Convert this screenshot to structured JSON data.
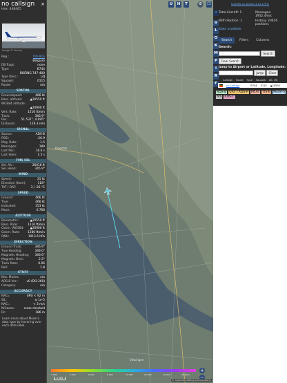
{
  "left_panel": {
    "callsign": "no callsign",
    "hex": "Hex: 448465",
    "close_glyph": "×",
    "photo_credit": "Image © Sxuuzy",
    "basic": [
      {
        "k": "Reg.:",
        "v": "OO-ACE",
        "link": true
      },
      {
        "k": "",
        "v": "Belgium",
        "link": false
      },
      {
        "k": "DB flags:",
        "v": "none",
        "link": false
      },
      {
        "k": "Type:",
        "v": "B744",
        "link": false
      },
      {
        "k": "",
        "v": "BOEING 747-400",
        "link": false
      },
      {
        "k": "Type Desc.:",
        "v": "L4J",
        "link": false
      },
      {
        "k": "Squawk:",
        "v": "0115",
        "link": false
      },
      {
        "k": "Route:",
        "v": "n/a",
        "link": false
      }
    ],
    "sections": [
      {
        "title": "SPATIAL",
        "rows": [
          {
            "k": "Groundspeed:",
            "v": "466 kt"
          },
          {
            "k": "Baro. altitude:",
            "v": "▲20550 ft"
          },
          {
            "k": "WGS84 altitude:",
            "v": ""
          },
          {
            "k": "",
            "v": "▲20900 ft"
          },
          {
            "k": "Vert. Rate:",
            "v": "1216 ft/min"
          },
          {
            "k": "Track:",
            "v": "346.9°"
          },
          {
            "k": "Pos.:",
            "v": "51.537°, 4.095°"
          },
          {
            "k": "Distance:",
            "v": "119.3 nmi"
          }
        ]
      },
      {
        "title": "SIGNAL",
        "rows": [
          {
            "k": "Source:",
            "v": "ADS-B"
          },
          {
            "k": "RSSI:",
            "v": "-26.9"
          },
          {
            "k": "Msg. Rate:",
            "v": "1.5"
          },
          {
            "k": "Messages:",
            "v": "189"
          },
          {
            "k": "Last Pos.:",
            "v": "16.6 s"
          },
          {
            "k": "Last Seen:",
            "v": "1.5 s"
          }
        ]
      },
      {
        "title": "FMS SEL",
        "rows": [
          {
            "k": "Sel. Alt.:",
            "v": "26016 ft"
          },
          {
            "k": "Sel. Head.:",
            "v": "345.9°"
          }
        ]
      },
      {
        "title": "WIND",
        "rows": [
          {
            "k": "Speed:",
            "v": "25 kt"
          },
          {
            "k": "Direction (from):",
            "v": "118°"
          },
          {
            "k": "TAT / OAT:",
            "v": "3 / -26 °C"
          }
        ]
      },
      {
        "title": "SPEED",
        "rows": [
          {
            "k": "Ground:",
            "v": "466 kt"
          },
          {
            "k": "True:",
            "v": "466 kt"
          },
          {
            "k": "Indicated:",
            "v": "353 kt"
          },
          {
            "k": "Mach:",
            "v": "0.768"
          }
        ]
      },
      {
        "title": "ALTITUDE",
        "rows": [
          {
            "k": "Barometric:",
            "v": "▲20550 ft"
          },
          {
            "k": "Baro. Rate:",
            "v": "1216 ft/min"
          },
          {
            "k": "Geom. WGS84:",
            "v": "▲20900 ft"
          },
          {
            "k": "Geom. Rate:",
            "v": "1280 ft/min"
          },
          {
            "k": "QNH:",
            "v": "1013.6 hPa"
          }
        ]
      },
      {
        "title": "DIRECTION",
        "rows": [
          {
            "k": "Ground Track:",
            "v": "346.9°"
          },
          {
            "k": "True Heading:",
            "v": "349.0°"
          },
          {
            "k": "Magnetic Heading:",
            "v": "346.6°"
          },
          {
            "k": "Magnetic Decl.:",
            "v": "2.5°"
          },
          {
            "k": "Track Rate:",
            "v": "0.06"
          },
          {
            "k": "Roll:",
            "v": "1.8"
          }
        ]
      },
      {
        "title": "STUFF",
        "rows": [
          {
            "k": "Nav. Modes:",
            "v": "n/a"
          },
          {
            "k": "ADS-B Ver.:",
            "v": "v0 (DO-260)"
          },
          {
            "k": "Category:",
            "v": "n/a"
          }
        ]
      },
      {
        "title": "ACCURACY",
        "rows": [
          {
            "k": "NAC₉:",
            "v": "EPU < 92 m"
          },
          {
            "k": "SIL:",
            "v": "≤ 1e-5"
          },
          {
            "k": "NACᵥ:",
            "v": "< 3 m/s"
          },
          {
            "k": "NICʙᴀʀᴏ:",
            "v": "cross-checked"
          },
          {
            "k": "Rᴄ:",
            "v": "186 m"
          }
        ]
      }
    ],
    "footer_note": "Learn more about Mode S data type by hovering over each data label."
  },
  "map": {
    "top_buttons": [
      "U",
      "H",
      "T"
    ],
    "side_buttons": [
      "L",
      "O",
      "K",
      "M",
      "P",
      "I",
      "R",
      "F"
    ],
    "zoom_in": "+",
    "zoom_out": "−",
    "scale_label": "2 NM",
    "attribution": "© OpenStreetMap contributors.",
    "altitude_labels": [
      "2 000",
      "4 000",
      "6 000",
      "8 000",
      "10 000",
      "20 000",
      "30 000",
      "40 000+"
    ],
    "place_labels": [
      "Kingston",
      "Vlissingen"
    ],
    "colors": {
      "water": "#4a5d6d",
      "land": "#7e8a78",
      "trail": "#5fd3e8",
      "plane": "#4fc7e0"
    }
  },
  "right_panel": {
    "top_link": "tar1090 on github (3.14.1707)",
    "stats": [
      {
        "k": "Total Aircraft: 1",
        "v": "Messages: 1952.4/sec"
      },
      {
        "k": "With Position: 1",
        "v": "History: 20616 positions"
      },
      {
        "k": "Stats available",
        "v": ""
      }
    ],
    "tabs": [
      "Search",
      "Filters",
      "Columns"
    ],
    "search_label": "Search:",
    "search_button": "Search",
    "clear_search_button": "Clear Search",
    "jump_label": "Jump to Airport or Latitude, Longitude:",
    "jump_button": "Jump",
    "clear_button": "Clear",
    "table_headers": [
      "Callsign",
      "Route",
      "Type",
      "Squawk",
      "Alt. (ft)"
    ],
    "table_row": {
      "callsign": "no callsign",
      "type": "B744",
      "squawk": "0115",
      "alt": "▲20550"
    },
    "source_legend": [
      {
        "label": "ADS-B",
        "bg": "#b5e3bf"
      },
      {
        "label": "UAT / ADS-R",
        "bg": "#f2c572"
      },
      {
        "label": "MLAT",
        "bg": "#f4b2a0"
      },
      {
        "label": "TIS-B",
        "bg": "#f7b48a"
      },
      {
        "label": "Mode-S",
        "bg": "#bcdaf2"
      },
      {
        "label": "AIS",
        "bg": "#cccccc"
      },
      {
        "label": "ADS-C",
        "bg": "#e7a7c6"
      }
    ]
  }
}
